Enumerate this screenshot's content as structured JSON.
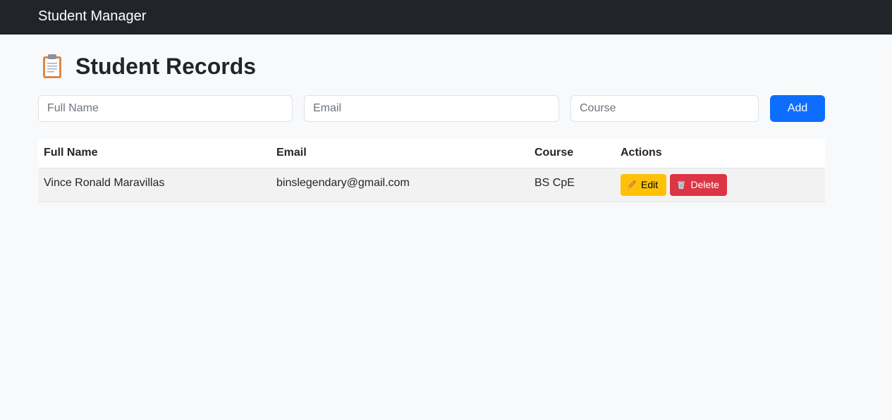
{
  "navbar": {
    "brand": "Student Manager"
  },
  "page": {
    "title": "Student Records",
    "title_icon": "clipboard-icon"
  },
  "form": {
    "name_placeholder": "Full Name",
    "email_placeholder": "Email",
    "course_placeholder": "Course",
    "add_label": "Add",
    "add_color": "#0d6efd"
  },
  "table": {
    "headers": [
      "Full Name",
      "Email",
      "Course",
      "Actions"
    ],
    "rows": [
      {
        "name": "Vince Ronald Maravillas",
        "email": "binslegendary@gmail.com",
        "course": "BS CpE",
        "edit_label": "Edit",
        "delete_label": "Delete"
      }
    ]
  },
  "colors": {
    "navbar": "#212529",
    "edit": "#ffc107",
    "delete": "#dc3545"
  },
  "icons": {
    "edit": "pencil-icon",
    "delete": "trash-icon"
  }
}
